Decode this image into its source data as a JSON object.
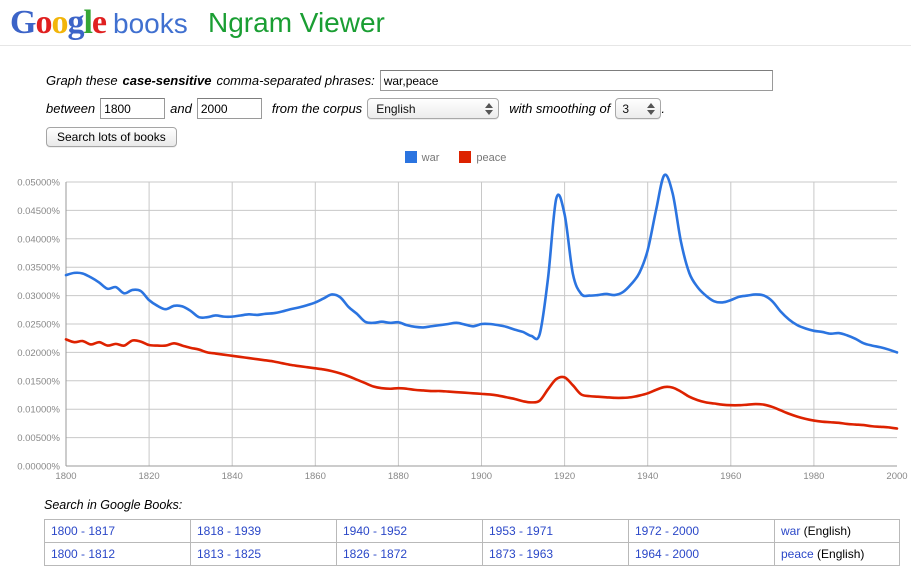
{
  "header": {
    "logo_letters": [
      {
        "ch": "G",
        "color": "#3c64c8"
      },
      {
        "ch": "o",
        "color": "#e02020"
      },
      {
        "ch": "o",
        "color": "#f2b50a"
      },
      {
        "ch": "g",
        "color": "#3c64c8"
      },
      {
        "ch": "l",
        "color": "#35a635"
      },
      {
        "ch": "e",
        "color": "#e02020"
      }
    ],
    "logo_suffix": "books",
    "product_title": "Ngram Viewer"
  },
  "form": {
    "label_graph_1": "Graph these",
    "label_graph_bold": "case-sensitive",
    "label_graph_2": "comma-separated phrases:",
    "phrases_value": "war,peace",
    "phrases_placeholder": "",
    "label_between": "between",
    "year_start_value": "1800",
    "label_and": "and",
    "year_end_value": "2000",
    "label_corpus": "from the corpus",
    "corpus_value": "English",
    "corpus_options": [
      "English"
    ],
    "label_smoothing": "with smoothing of",
    "smoothing_value": "3",
    "smoothing_options": [
      "3"
    ],
    "label_period": ".",
    "search_button": "Search lots of books"
  },
  "legend": [
    {
      "label": "war",
      "color": "#2b74e0"
    },
    {
      "label": "peace",
      "color": "#dd2200"
    }
  ],
  "search_section": {
    "label": "Search in Google Books:",
    "rows": [
      {
        "ranges": [
          "1800 - 1817",
          "1818 - 1939",
          "1940 - 1952",
          "1953 - 1971",
          "1972 - 2000"
        ],
        "term": "war",
        "lang": "(English)"
      },
      {
        "ranges": [
          "1800 - 1812",
          "1813 - 1825",
          "1826 - 1872",
          "1873 - 1963",
          "1964 - 2000"
        ],
        "term": "peace",
        "lang": "(English)"
      }
    ]
  },
  "chart_data": {
    "type": "line",
    "title": "",
    "xlabel": "",
    "ylabel": "",
    "xlim": [
      1800,
      2000
    ],
    "ylim": [
      0.0,
      0.05
    ],
    "grid": true,
    "legend_position": "top-center",
    "x_ticks": [
      1800,
      1820,
      1840,
      1860,
      1880,
      1900,
      1920,
      1940,
      1960,
      1980,
      2000
    ],
    "y_ticks": [
      0.0,
      0.005,
      0.01,
      0.015,
      0.02,
      0.025,
      0.03,
      0.035,
      0.04,
      0.045,
      0.05
    ],
    "y_tick_labels": [
      "0.00000%",
      "0.00500%",
      "0.01000%",
      "0.01500%",
      "0.02000%",
      "0.02500%",
      "0.03000%",
      "0.03500%",
      "0.04000%",
      "0.04500%",
      "0.05000%"
    ],
    "x_tick_labels": [
      "1800",
      "1820",
      "1840",
      "1860",
      "1880",
      "1900",
      "1920",
      "1940",
      "1960",
      "1980",
      "2000"
    ],
    "unit": "percent",
    "series": [
      {
        "name": "war",
        "color": "#2b74e0",
        "x": [
          1800,
          1802,
          1804,
          1806,
          1808,
          1810,
          1812,
          1814,
          1816,
          1818,
          1820,
          1822,
          1824,
          1826,
          1828,
          1830,
          1832,
          1834,
          1836,
          1838,
          1840,
          1842,
          1844,
          1846,
          1848,
          1850,
          1852,
          1854,
          1856,
          1858,
          1860,
          1862,
          1864,
          1866,
          1868,
          1870,
          1872,
          1874,
          1876,
          1878,
          1880,
          1882,
          1884,
          1886,
          1888,
          1890,
          1892,
          1894,
          1896,
          1898,
          1900,
          1902,
          1904,
          1906,
          1908,
          1910,
          1912,
          1914,
          1916,
          1918,
          1920,
          1922,
          1924,
          1926,
          1928,
          1930,
          1932,
          1934,
          1936,
          1938,
          1940,
          1942,
          1944,
          1946,
          1948,
          1950,
          1952,
          1954,
          1956,
          1958,
          1960,
          1962,
          1964,
          1966,
          1968,
          1970,
          1972,
          1974,
          1976,
          1978,
          1980,
          1982,
          1984,
          1986,
          1988,
          1990,
          1992,
          1994,
          1996,
          1998,
          2000
        ],
        "y": [
          0.0336,
          0.034,
          0.0339,
          0.0332,
          0.0323,
          0.0312,
          0.0315,
          0.0304,
          0.031,
          0.0308,
          0.0292,
          0.0282,
          0.0276,
          0.0282,
          0.0281,
          0.0273,
          0.0262,
          0.0262,
          0.0265,
          0.0263,
          0.0263,
          0.0265,
          0.0267,
          0.0266,
          0.0268,
          0.0269,
          0.0272,
          0.0276,
          0.0279,
          0.0283,
          0.0288,
          0.0295,
          0.0302,
          0.0297,
          0.028,
          0.0268,
          0.0254,
          0.0252,
          0.0254,
          0.0252,
          0.0253,
          0.0248,
          0.0245,
          0.0244,
          0.0246,
          0.0248,
          0.025,
          0.0252,
          0.0249,
          0.0246,
          0.025,
          0.025,
          0.0248,
          0.0245,
          0.024,
          0.0236,
          0.0229,
          0.0232,
          0.033,
          0.0471,
          0.0443,
          0.0338,
          0.0303,
          0.03,
          0.0301,
          0.0303,
          0.0301,
          0.0306,
          0.032,
          0.034,
          0.038,
          0.045,
          0.0512,
          0.048,
          0.0395,
          0.034,
          0.0315,
          0.03,
          0.029,
          0.0288,
          0.0292,
          0.0298,
          0.03,
          0.0302,
          0.03,
          0.029,
          0.0272,
          0.0258,
          0.0248,
          0.0242,
          0.0238,
          0.0236,
          0.0233,
          0.0234,
          0.023,
          0.0224,
          0.0216,
          0.0212,
          0.0209,
          0.0205,
          0.02
        ]
      },
      {
        "name": "peace",
        "color": "#dd2200",
        "x": [
          1800,
          1802,
          1804,
          1806,
          1808,
          1810,
          1812,
          1814,
          1816,
          1818,
          1820,
          1822,
          1824,
          1826,
          1828,
          1830,
          1832,
          1834,
          1836,
          1838,
          1840,
          1842,
          1844,
          1846,
          1848,
          1850,
          1852,
          1854,
          1856,
          1858,
          1860,
          1862,
          1864,
          1866,
          1868,
          1870,
          1872,
          1874,
          1876,
          1878,
          1880,
          1882,
          1884,
          1886,
          1888,
          1890,
          1892,
          1894,
          1896,
          1898,
          1900,
          1902,
          1904,
          1906,
          1908,
          1910,
          1912,
          1914,
          1916,
          1918,
          1920,
          1922,
          1924,
          1926,
          1928,
          1930,
          1932,
          1934,
          1936,
          1938,
          1940,
          1942,
          1944,
          1946,
          1948,
          1950,
          1952,
          1954,
          1956,
          1958,
          1960,
          1962,
          1964,
          1966,
          1968,
          1970,
          1972,
          1974,
          1976,
          1978,
          1980,
          1982,
          1984,
          1986,
          1988,
          1990,
          1992,
          1994,
          1996,
          1998,
          2000
        ],
        "y": [
          0.0223,
          0.0218,
          0.022,
          0.0214,
          0.0218,
          0.0212,
          0.0215,
          0.0212,
          0.0221,
          0.0219,
          0.0213,
          0.0212,
          0.0212,
          0.0216,
          0.0212,
          0.0208,
          0.0205,
          0.02,
          0.0198,
          0.0196,
          0.0194,
          0.0192,
          0.019,
          0.0188,
          0.0186,
          0.0184,
          0.0181,
          0.0178,
          0.0176,
          0.0174,
          0.0172,
          0.017,
          0.0167,
          0.0163,
          0.0158,
          0.0152,
          0.0146,
          0.014,
          0.0137,
          0.0136,
          0.0137,
          0.0136,
          0.0134,
          0.0133,
          0.0132,
          0.0132,
          0.0131,
          0.013,
          0.0129,
          0.0128,
          0.0127,
          0.0126,
          0.0124,
          0.0121,
          0.0118,
          0.0114,
          0.0112,
          0.0115,
          0.0135,
          0.0153,
          0.0156,
          0.0142,
          0.0126,
          0.0123,
          0.0122,
          0.0121,
          0.012,
          0.012,
          0.0121,
          0.0124,
          0.0128,
          0.0134,
          0.0139,
          0.0138,
          0.0131,
          0.0122,
          0.0116,
          0.0112,
          0.011,
          0.0108,
          0.0107,
          0.0107,
          0.0108,
          0.0109,
          0.0108,
          0.0104,
          0.0098,
          0.0092,
          0.0087,
          0.0083,
          0.008,
          0.0078,
          0.0077,
          0.0076,
          0.0074,
          0.0073,
          0.0072,
          0.007,
          0.0069,
          0.0068,
          0.0066
        ]
      }
    ]
  }
}
